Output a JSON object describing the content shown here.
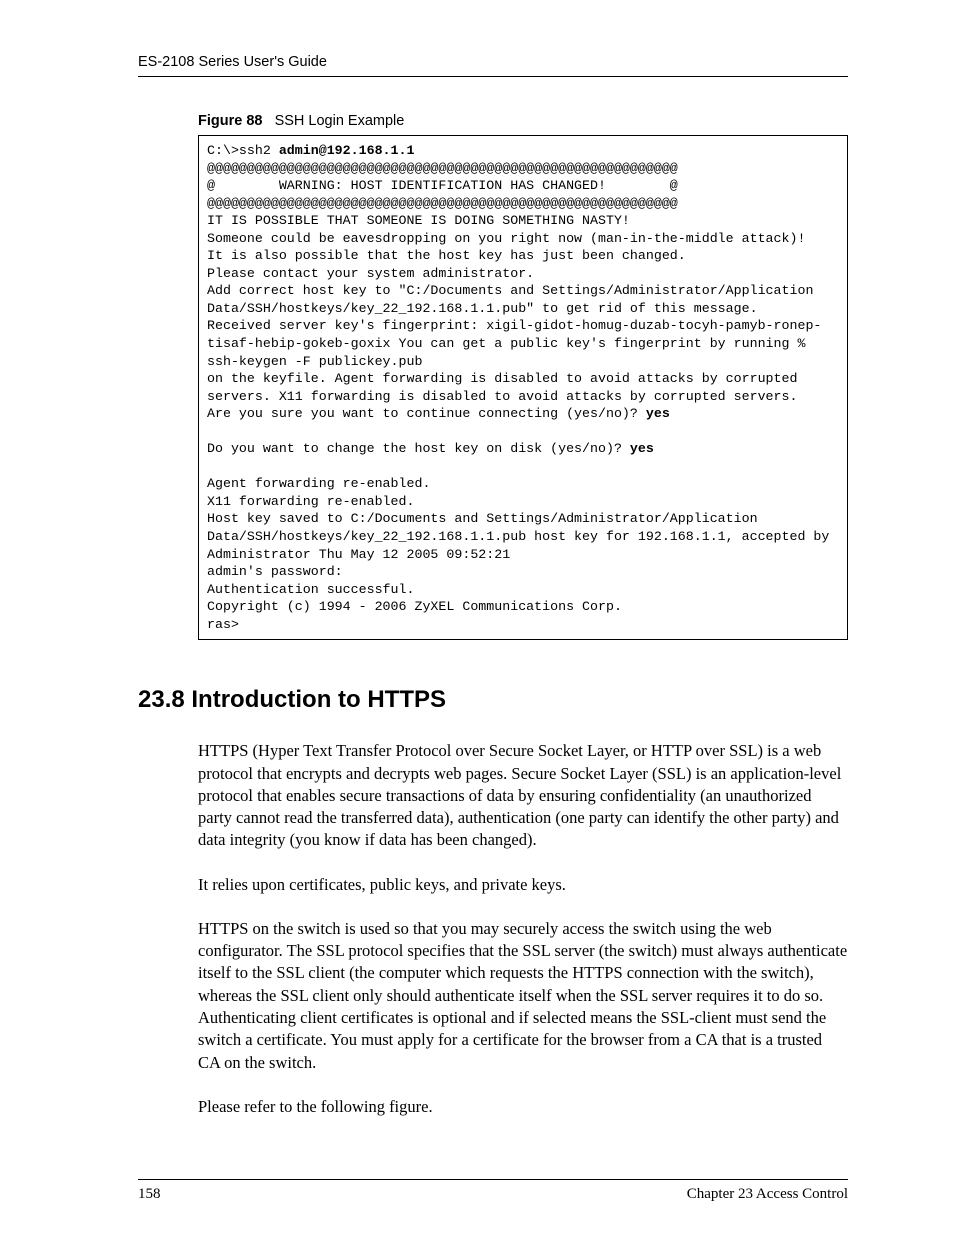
{
  "header": {
    "running_head": "ES-2108 Series User's Guide"
  },
  "figure": {
    "label": "Figure 88",
    "title": "SSH Login Example",
    "code_prefix": "C:\\>ssh2 ",
    "code_bold1": "admin@192.168.1.1",
    "code_body1": "\n@@@@@@@@@@@@@@@@@@@@@@@@@@@@@@@@@@@@@@@@@@@@@@@@@@@@@@@@@@@\n@        WARNING: HOST IDENTIFICATION HAS CHANGED!        @\n@@@@@@@@@@@@@@@@@@@@@@@@@@@@@@@@@@@@@@@@@@@@@@@@@@@@@@@@@@@\nIT IS POSSIBLE THAT SOMEONE IS DOING SOMETHING NASTY!\nSomeone could be eavesdropping on you right now (man-in-the-middle attack)!\nIt is also possible that the host key has just been changed.\nPlease contact your system administrator.\nAdd correct host key to \"C:/Documents and Settings/Administrator/Application Data/SSH/hostkeys/key_22_192.168.1.1.pub\" to get rid of this message.\nReceived server key's fingerprint: xigil-gidot-homug-duzab-tocyh-pamyb-ronep-tisaf-hebip-gokeb-goxix You can get a public key's fingerprint by running % ssh-keygen -F publickey.pub\non the keyfile. Agent forwarding is disabled to avoid attacks by corrupted servers. X11 forwarding is disabled to avoid attacks by corrupted servers.\nAre you sure you want to continue connecting (yes/no)? ",
    "code_bold2": "yes",
    "code_body2": "\n\nDo you want to change the host key on disk (yes/no)? ",
    "code_bold3": "yes",
    "code_body3": "\n\nAgent forwarding re-enabled.\nX11 forwarding re-enabled.\nHost key saved to C:/Documents and Settings/Administrator/Application Data/SSH/hostkeys/key_22_192.168.1.1.pub host key for 192.168.1.1, accepted by Administrator Thu May 12 2005 09:52:21\nadmin's password:\nAuthentication successful.\nCopyright (c) 1994 - 2006 ZyXEL Communications Corp.\nras>"
  },
  "section": {
    "heading": "23.8  Introduction to HTTPS",
    "p1": "HTTPS (Hyper Text Transfer Protocol over Secure Socket Layer, or HTTP over SSL) is a web protocol that encrypts and decrypts web pages. Secure Socket Layer (SSL) is an application-level protocol that enables secure transactions of data by ensuring confidentiality (an unauthorized party cannot read the transferred data), authentication (one party can identify the other party) and data integrity (you know if data has been changed).",
    "p2": "It relies upon certificates, public keys, and private keys.",
    "p3": "HTTPS on the switch is used so that you may securely access the switch using the web configurator. The SSL protocol specifies that the SSL server (the switch) must always authenticate itself to the SSL client (the computer which requests the HTTPS connection with the switch), whereas the SSL client only should authenticate itself when the SSL server requires it to do so. Authenticating client certificates is optional and if selected means the SSL-client must send the switch a certificate. You must apply for a certificate for the browser from a CA that is a trusted CA on the switch.",
    "p4": "Please refer to the following figure."
  },
  "footer": {
    "page": "158",
    "chapter": "Chapter 23 Access Control"
  }
}
